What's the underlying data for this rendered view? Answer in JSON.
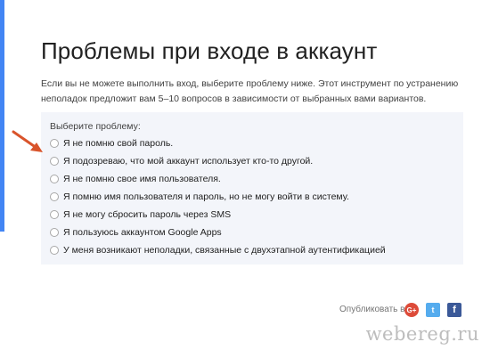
{
  "page": {
    "title": "Проблемы при входе в аккаунт",
    "intro": "Если вы не можете выполнить вход, выберите проблему ниже. Этот инструмент по устранению неполадок предложит вам 5–10 вопросов в зависимости от выбранных вами вариантов."
  },
  "problems": {
    "label": "Выберите проблему:",
    "options": [
      "Я не помню свой пароль.",
      "Я подозреваю, что мой аккаунт использует кто-то другой.",
      "Я не помню свое имя пользователя.",
      "Я помню имя пользователя и пароль, но не могу войти в систему.",
      "Я не могу сбросить пароль через SMS",
      "Я пользуюсь аккаунтом Google Apps",
      "У меня возникают неполадки, связанные с двухэтапной аутентификацией"
    ]
  },
  "share": {
    "label": "Опубликовать в:",
    "google_plus": "G+",
    "twitter": "t",
    "facebook": "f"
  },
  "watermark": "webereg.ru",
  "colors": {
    "accent_blue": "#4285f4",
    "panel_bg": "#f3f5fa",
    "arrow_red": "#d9542b",
    "gplus": "#dd4b39",
    "twitter": "#55acee",
    "facebook": "#3b5998"
  },
  "icons": {
    "arrow": "red-arrow-pointer-icon",
    "google_plus": "google-plus-icon",
    "twitter": "twitter-icon",
    "facebook": "facebook-icon"
  }
}
